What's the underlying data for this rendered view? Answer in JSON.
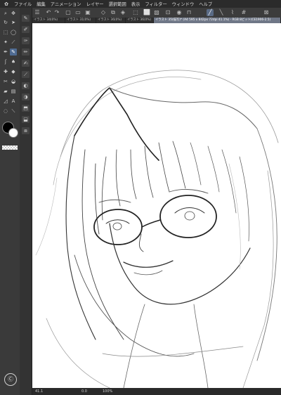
{
  "menubar": {
    "items": [
      "ファイル",
      "編集",
      "アニメーション",
      "レイヤー",
      "選択範囲",
      "表示",
      "フィルター",
      "ウィンドウ",
      "ヘルプ"
    ]
  },
  "tabs": [
    {
      "label": "イラスト 34(0%)"
    },
    {
      "label": "イラスト 31(0%)"
    },
    {
      "label": "イラスト 36(0%)"
    },
    {
      "label": "イラスト 36(0%)"
    },
    {
      "label": "イラスト 35(描写)* (A4 595 x 842px 72dpi 41.1%) - RGB 8ビット(CE1906-2.5)"
    }
  ],
  "statusbar": {
    "zoom": "41.1",
    "angle": "0.0",
    "extra": "100%"
  },
  "icons": {
    "fg_color": "#000000",
    "bg_color": "#ffffff",
    "accent": "#5a6b85"
  }
}
